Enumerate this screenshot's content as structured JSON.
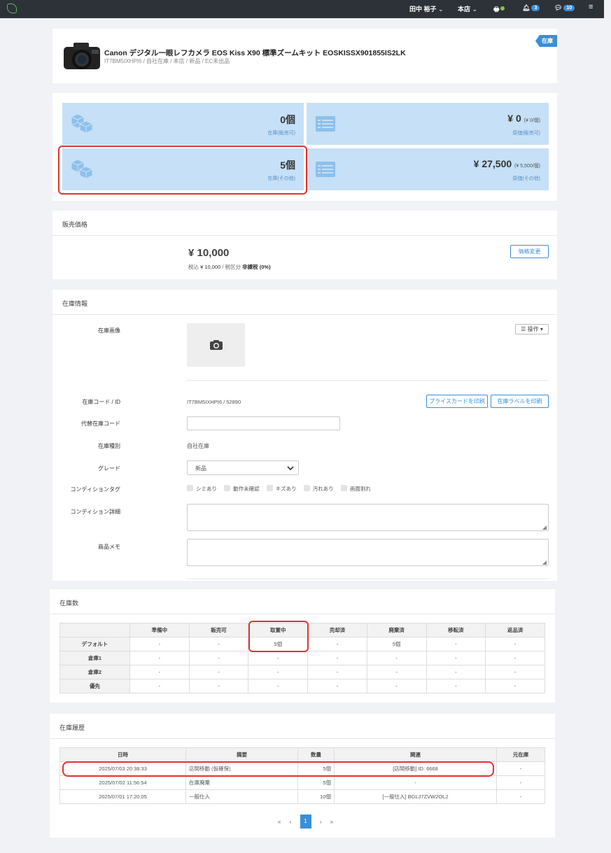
{
  "topbar": {
    "user": "田中 裕子",
    "store": "本店",
    "notifications": "3",
    "messages": "10"
  },
  "product": {
    "title": "Canon デジタル一眼レフカメラ EOS Kiss X90 標準ズームキット EOSKISSX901855IS2LK",
    "subtitle": "IT7BM5IXHPI6 / 自社在庫 / 本店 / 新品 / EC未出品",
    "status_tag": "在庫"
  },
  "summary": {
    "tiles": [
      {
        "value": "0個",
        "small": "",
        "label": "在庫(販売可)"
      },
      {
        "value": "¥ 0",
        "small": "(¥ 0/個)",
        "label": "原価(販売可)"
      },
      {
        "value": "5個",
        "small": "",
        "label": "在庫(その他)"
      },
      {
        "value": "¥ 27,500",
        "small": "(¥ 5,500/個)",
        "label": "原価(その他)"
      }
    ]
  },
  "price": {
    "section_title": "販売価格",
    "amount": "¥ 10,000",
    "tax_prefix": "税込",
    "tax_amount": "¥ 10,000",
    "tax_sep": "/ 税区分",
    "tax_class": "非課税 (0%)",
    "change_button": "価格変更"
  },
  "stock_info": {
    "section_title": "在庫情報",
    "image_label": "在庫画像",
    "ops_button": "操作",
    "code_label": "在庫コード / ID",
    "code_value": "IT7BM5IXHPI6 / 52890",
    "print_price_card": "プライスカードを印刷",
    "print_label": "在庫ラベルを印刷",
    "alt_code_label": "代替在庫コード",
    "alt_code_value": "",
    "type_label": "在庫種別",
    "type_value": "自社在庫",
    "grade_label": "グレード",
    "grade_value": "新品",
    "cond_tag_label": "コンディションタグ",
    "cond_tags": [
      "シミあり",
      "動作未確認",
      "キズあり",
      "汚れあり",
      "画面割れ"
    ],
    "cond_detail_label": "コンディション詳細",
    "memo_label": "商品メモ"
  },
  "stock_counts": {
    "section_title": "在庫数",
    "headers": [
      "",
      "準備中",
      "販売可",
      "取置中",
      "売却済",
      "廃棄済",
      "移転済",
      "返品済"
    ],
    "rows": [
      [
        "デフォルト",
        "-",
        "-",
        "5個",
        "-",
        "5個",
        "-",
        "-"
      ],
      [
        "倉庫1",
        "-",
        "-",
        "-",
        "-",
        "-",
        "-",
        "-"
      ],
      [
        "倉庫2",
        "-",
        "-",
        "-",
        "-",
        "-",
        "-",
        "-"
      ],
      [
        "優先",
        "-",
        "-",
        "-",
        "-",
        "-",
        "-",
        "-"
      ]
    ]
  },
  "history": {
    "section_title": "在庫履歴",
    "headers": [
      "日時",
      "摘要",
      "数量",
      "関連",
      "元在庫"
    ],
    "rows": [
      [
        "2025/07/03 20:38:33",
        "店間移動 (仮確保)",
        "5個",
        "[店間移動] ID: 6668",
        "-"
      ],
      [
        "2025/07/02 11:56:54",
        "在庫廃棄",
        "5個",
        "-",
        "-"
      ],
      [
        "2025/07/01 17:20:05",
        "一般仕入",
        "10個",
        "[一般仕入] BGLJ7ZVW2OL2",
        "-"
      ]
    ],
    "pager": {
      "first": "«",
      "prev": "‹",
      "current": "1",
      "next": "›",
      "last": "»"
    }
  }
}
